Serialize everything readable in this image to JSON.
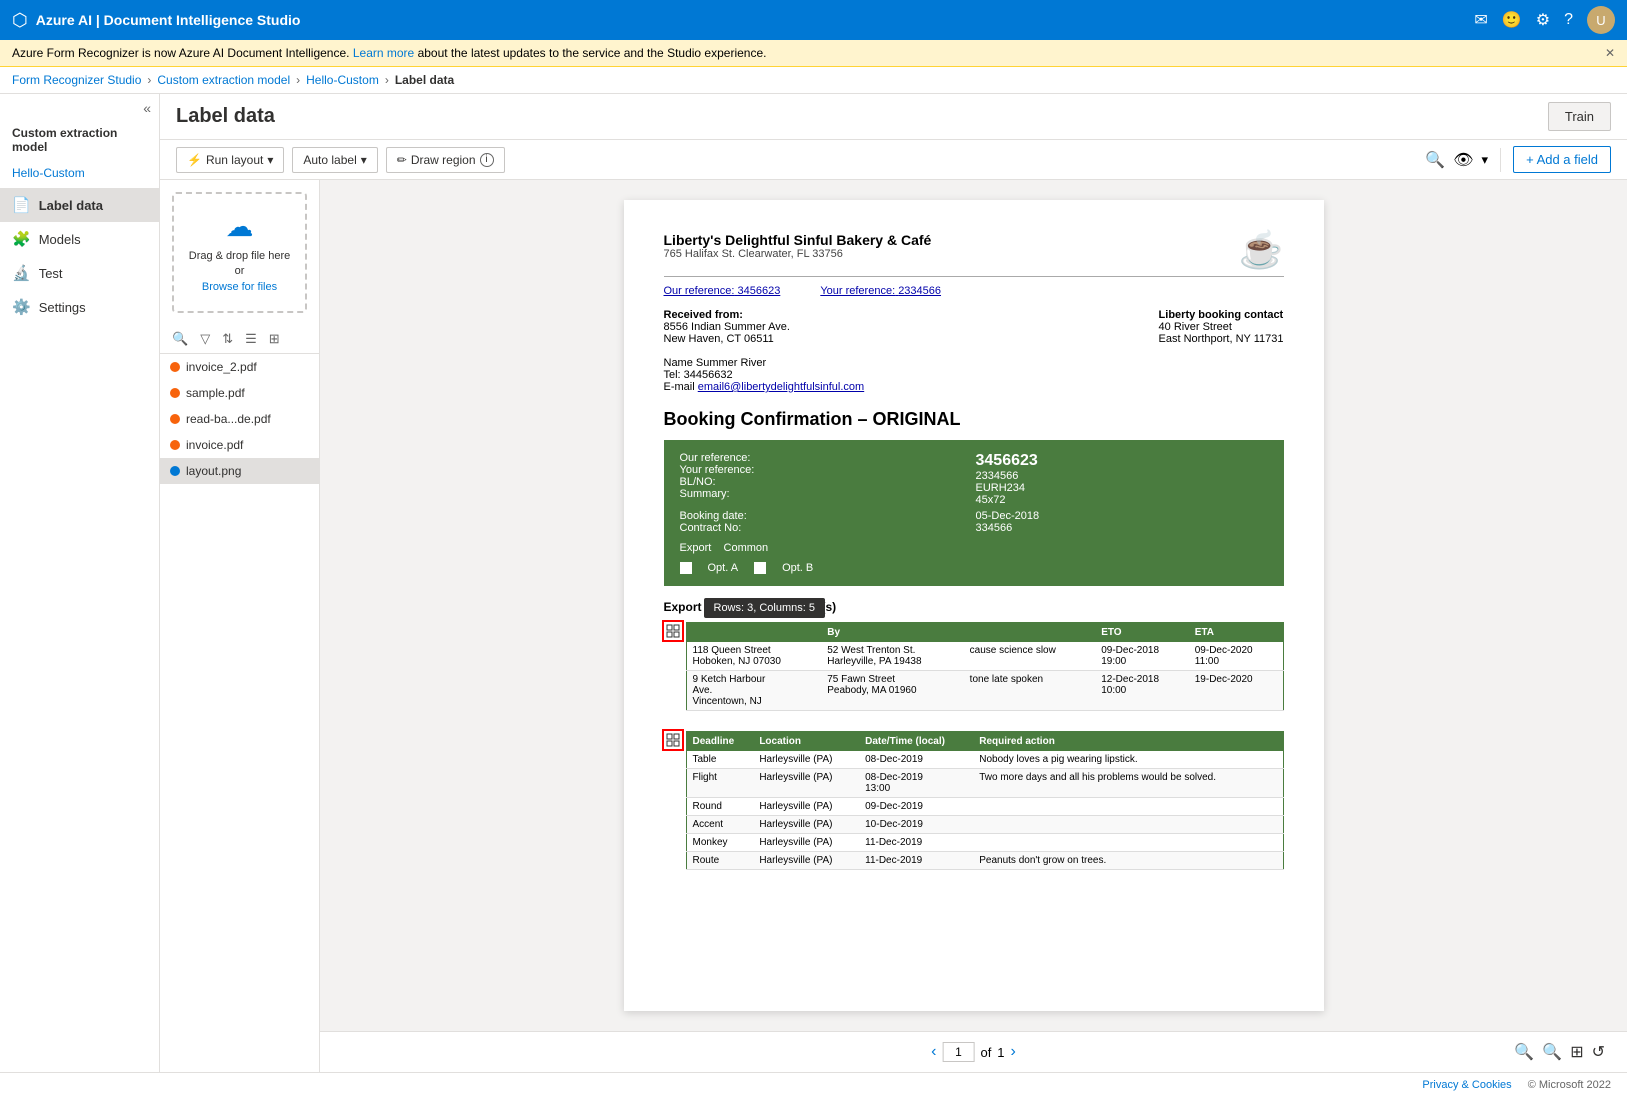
{
  "topbar": {
    "title": "Azure AI | Document Intelligence Studio",
    "icons": [
      "email-icon",
      "emoji-icon",
      "settings-icon",
      "help-icon",
      "user-icon"
    ]
  },
  "notification": {
    "text": "Azure Form Recognizer is now Azure AI Document Intelligence.",
    "link_text": "Learn more",
    "link_suffix": " about the latest updates to the service and the Studio experience."
  },
  "breadcrumb": {
    "items": [
      "Form Recognizer Studio",
      "Custom extraction model",
      "Hello-Custom",
      "Label data"
    ]
  },
  "sidebar": {
    "collapse_title": "«",
    "section_title": "Custom extraction model",
    "project_name": "Hello-Custom",
    "items": [
      {
        "id": "label-data",
        "label": "Label data",
        "icon": "📄",
        "active": true
      },
      {
        "id": "models",
        "label": "Models",
        "icon": "🧩",
        "active": false
      },
      {
        "id": "test",
        "label": "Test",
        "icon": "🔬",
        "active": false
      },
      {
        "id": "settings",
        "label": "Settings",
        "icon": "⚙️",
        "active": false
      }
    ]
  },
  "page": {
    "title": "Label data",
    "train_button": "Train"
  },
  "toolbar": {
    "run_layout_label": "Run layout",
    "auto_label_label": "Auto label",
    "draw_region_label": "Draw region",
    "add_field_label": "+ Add a field"
  },
  "file_panel": {
    "upload": {
      "drag_text": "Drag & drop file here or",
      "browse_text": "Browse for files"
    },
    "files": [
      {
        "name": "invoice_2.pdf",
        "color": "orange"
      },
      {
        "name": "sample.pdf",
        "color": "orange"
      },
      {
        "name": "read-ba...de.pdf",
        "color": "orange"
      },
      {
        "name": "invoice.pdf",
        "color": "orange"
      },
      {
        "name": "layout.png",
        "color": "blue",
        "selected": true
      }
    ]
  },
  "document": {
    "bakery_name": "Liberty's Delightful Sinful Bakery & Café",
    "bakery_address": "765 Halifax St. Clearwater, FL 33756",
    "our_ref_label": "Our reference:",
    "our_ref_val": "3456623",
    "your_ref_label": "Your reference:",
    "your_ref_val": "2334566",
    "received_label": "Received from:",
    "received_addr1": "8556 Indian Summer Ave.",
    "received_addr2": "New Haven, CT 06511",
    "contact_label": "Liberty booking contact",
    "contact_addr1": "40 River Street",
    "contact_addr2": "East Northport, NY 11731",
    "name_label": "Name Summer River",
    "tel_label": "Tel: 34456632",
    "email_label": "E-mail",
    "email_val": "email6@libertydelightfulsinful.com",
    "booking_title": "Booking Confirmation – ORIGINAL",
    "green_box": {
      "our_ref": "Our reference:",
      "our_ref_val": "3456623",
      "your_ref": "Your reference:",
      "your_ref_val": "2334566",
      "blno": "BL/NO:",
      "blno_val": "EURH234",
      "summary": "Summary:",
      "summary_val": "45x72",
      "booking_date": "Booking date:",
      "booking_date_val": "05-Dec-2018",
      "contract_no": "Contract No:",
      "contract_no_val": "334566",
      "export": "Export",
      "export_val": "Common",
      "opt_a": "Opt. A",
      "opt_b": "Opt. B"
    },
    "export_pickup_label": "Export empty pick up depot(s)",
    "table1_tooltip": "Rows: 3, Columns: 5",
    "table1_headers": [
      "",
      "By",
      "ETO",
      "ETA"
    ],
    "table1_rows": [
      [
        "118 Queen Street\nHoboken, NJ 07030",
        "52 West Trenton St.\nHarleyville, PA 19438",
        "cause science slow",
        "09-Dec-2018\n19:00",
        "09-Dec-2020\n11:00"
      ],
      [
        "9 Ketch Harbour\nAve.\nVincentown, NJ",
        "75 Fawn Street\nPeabody, MA 01960",
        "tone late spoken",
        "12-Dec-2018\n10:00",
        "19-Dec-2020"
      ]
    ],
    "table2_headers": [
      "Deadline",
      "Location",
      "Date/Time (local)",
      "Required action"
    ],
    "table2_rows": [
      [
        "Table",
        "Harleysville (PA)",
        "08-Dec-2019",
        "Nobody loves a pig wearing lipstick."
      ],
      [
        "Flight",
        "Harleysville (PA)",
        "08-Dec-2019\n13:00",
        "Two more days and all his problems would be solved."
      ],
      [
        "Round",
        "Harleysville (PA)",
        "09-Dec-2019",
        ""
      ],
      [
        "Accent",
        "Harleysville (PA)",
        "10-Dec-2019",
        ""
      ],
      [
        "Monkey",
        "Harleysville (PA)",
        "11-Dec-2019",
        ""
      ],
      [
        "Route",
        "Harleysville (PA)",
        "11-Dec-2019",
        "Peanuts don't grow on trees."
      ]
    ]
  },
  "pagination": {
    "current": "1",
    "total": "1",
    "of_label": "of"
  },
  "footer": {
    "privacy": "Privacy & Cookies",
    "copyright": "© Microsoft 2022"
  }
}
